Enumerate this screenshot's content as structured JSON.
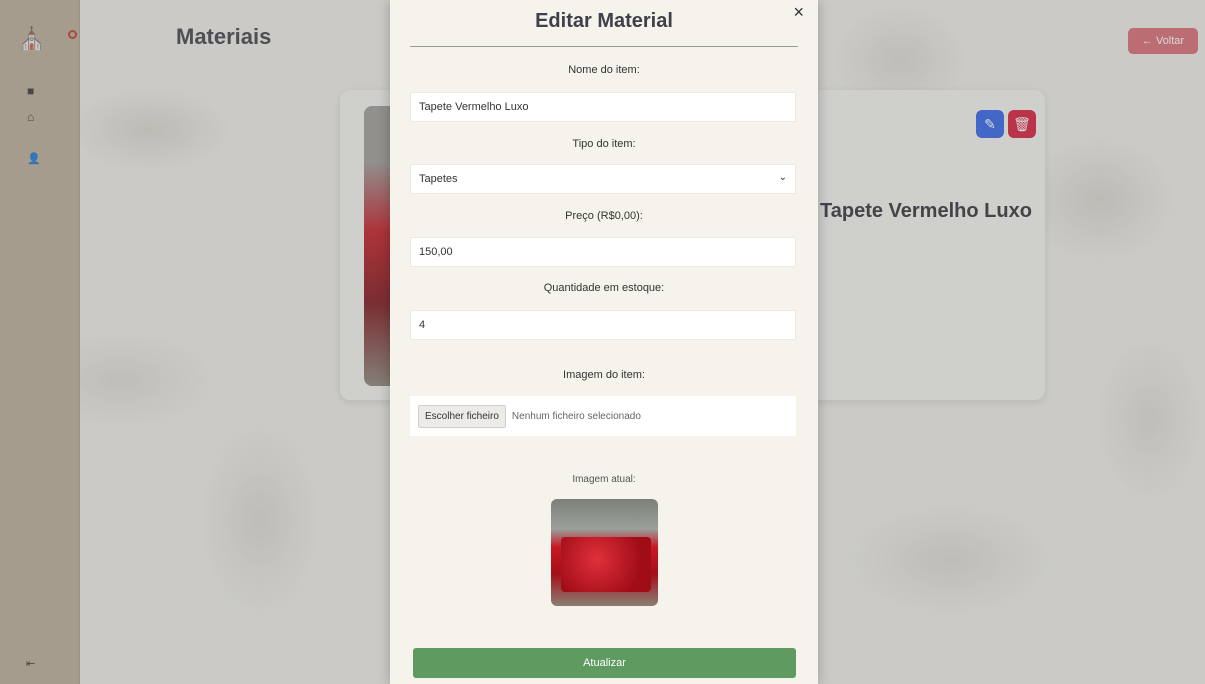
{
  "app": {
    "page_title": "Materiais",
    "back_label": "← Voltar"
  },
  "sidebar": {
    "logo_icon": "⛪",
    "nav": [
      {
        "icon": "grid-icon",
        "glyph": "■"
      },
      {
        "icon": "home-icon",
        "glyph": "⌂"
      },
      {
        "icon": "user-icon",
        "glyph": "👤"
      }
    ],
    "bottom_glyph": "⇤"
  },
  "card": {
    "title": "Tapete Vermelho Luxo",
    "edit_glyph": "✎",
    "delete_glyph": "🗑"
  },
  "modal": {
    "title": "Editar Material",
    "close_glyph": "×",
    "name_label": "Nome do item:",
    "name_value": "Tapete Vermelho Luxo",
    "type_label": "Tipo do item:",
    "type_value": "Tapetes",
    "price_label": "Preço (R$0,00):",
    "price_value": "150,00",
    "qty_label": "Quantidade em estoque:",
    "qty_value": "4",
    "image_label": "Imagem do item:",
    "file_button": "Escolher ficheiro",
    "file_status": "Nenhum ficheiro selecionado",
    "current_image_label": "Imagem atual:",
    "submit_label": "Atualizar"
  },
  "colors": {
    "sidebar": "#b7ab97",
    "submit": "#5f9a61",
    "back": "#d66a72",
    "edit": "#2f62e6",
    "delete": "#d31a38"
  }
}
